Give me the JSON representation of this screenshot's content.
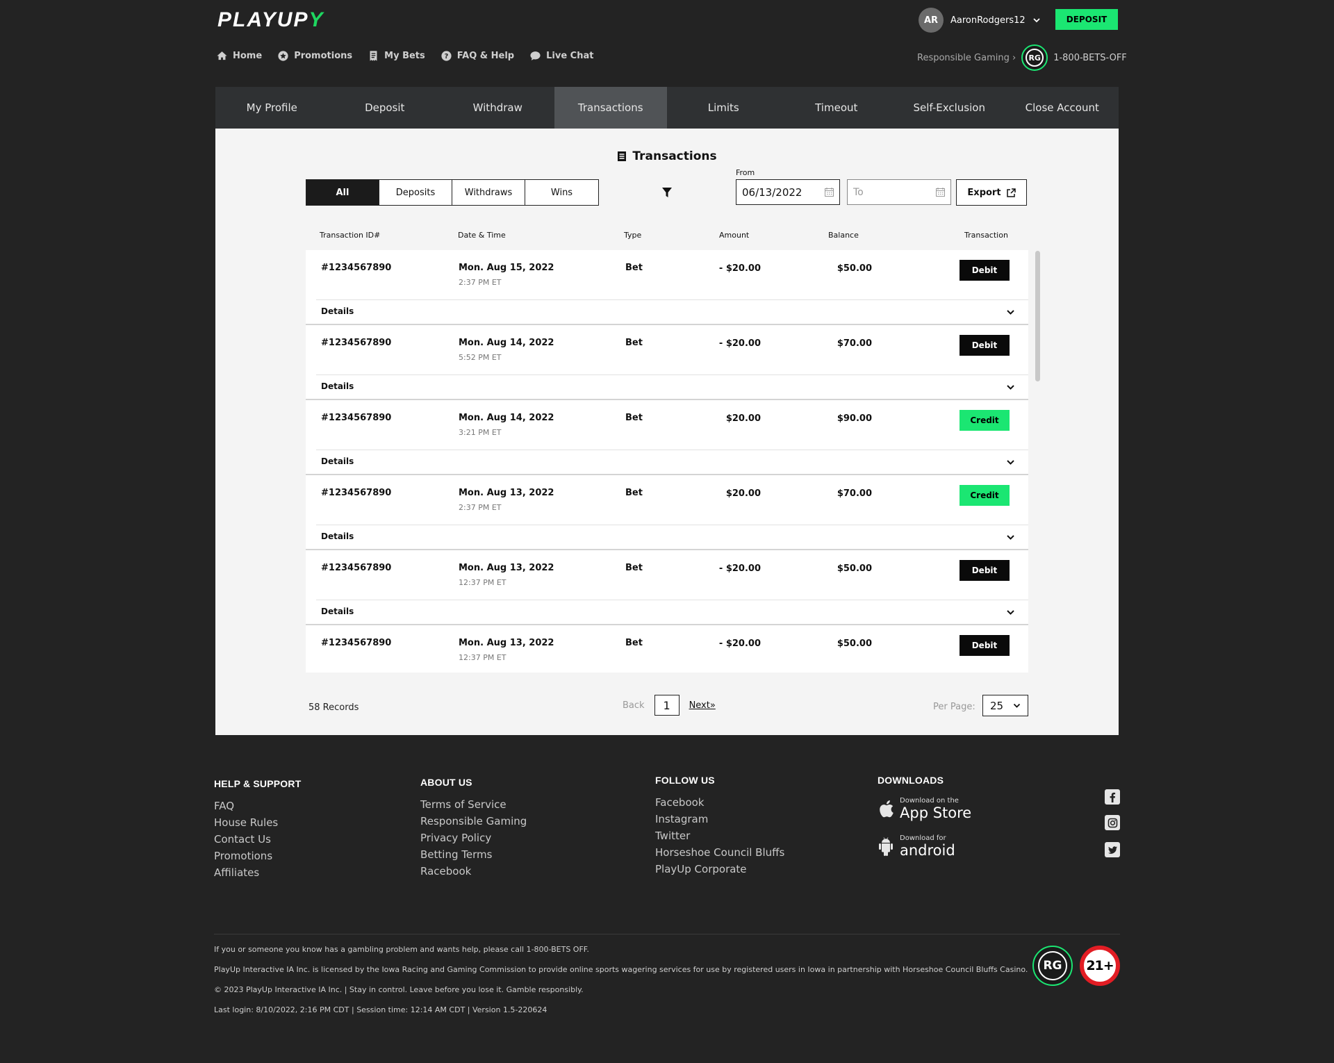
{
  "brand": {
    "logo_text": "PLAYUP",
    "accent": "#1be672"
  },
  "header": {
    "nav": [
      {
        "label": "Home",
        "icon": "home-icon"
      },
      {
        "label": "Promotions",
        "icon": "star-icon"
      },
      {
        "label": "My Bets",
        "icon": "receipt-icon"
      },
      {
        "label": "FAQ & Help",
        "icon": "help-icon"
      },
      {
        "label": "Live Chat",
        "icon": "chat-icon"
      }
    ],
    "user": {
      "initials": "AR",
      "username": "AaronRodgers12"
    },
    "deposit_label": "DEPOSIT",
    "responsible_gaming_label": "Responsible Gaming",
    "rg_badge": "RG",
    "helpline": "1-800-BETS-OFF"
  },
  "account_tabs": [
    {
      "label": "My Profile"
    },
    {
      "label": "Deposit"
    },
    {
      "label": "Withdraw"
    },
    {
      "label": "Transactions",
      "active": true
    },
    {
      "label": "Limits"
    },
    {
      "label": "Timeout"
    },
    {
      "label": "Self-Exclusion"
    },
    {
      "label": "Close Account"
    }
  ],
  "transactions": {
    "title": "Transactions",
    "filters": [
      {
        "label": "All",
        "active": true
      },
      {
        "label": "Deposits"
      },
      {
        "label": "Withdraws"
      },
      {
        "label": "Wins"
      }
    ],
    "from_label": "From",
    "from_value": "06/13/2022",
    "to_placeholder": "To",
    "export_label": "Export",
    "columns": [
      "Transaction ID#",
      "Date & Time",
      "Type",
      "Amount",
      "Balance",
      "Transaction"
    ],
    "details_label": "Details",
    "rows": [
      {
        "id": "#1234567890",
        "date": "Mon. Aug 15, 2022",
        "time": "2:37 PM ET",
        "type": "Bet",
        "amount": "- $20.00",
        "balance": "$50.00",
        "transaction": "Debit"
      },
      {
        "id": "#1234567890",
        "date": "Mon. Aug 14, 2022",
        "time": "5:52 PM ET",
        "type": "Bet",
        "amount": "- $20.00",
        "balance": "$70.00",
        "transaction": "Debit"
      },
      {
        "id": "#1234567890",
        "date": "Mon. Aug 14, 2022",
        "time": "3:21 PM ET",
        "type": "Bet",
        "amount": "$20.00",
        "balance": "$90.00",
        "transaction": "Credit"
      },
      {
        "id": "#1234567890",
        "date": "Mon. Aug 13, 2022",
        "time": "2:37 PM ET",
        "type": "Bet",
        "amount": "$20.00",
        "balance": "$70.00",
        "transaction": "Credit"
      },
      {
        "id": "#1234567890",
        "date": "Mon. Aug 13, 2022",
        "time": "12:37 PM ET",
        "type": "Bet",
        "amount": "- $20.00",
        "balance": "$50.00",
        "transaction": "Debit"
      },
      {
        "id": "#1234567890",
        "date": "Mon. Aug 13, 2022",
        "time": "12:37 PM ET",
        "type": "Bet",
        "amount": "- $20.00",
        "balance": "$50.00",
        "transaction": "Debit"
      }
    ],
    "records_label": "58 Records",
    "pager": {
      "back": "Back",
      "page": "1",
      "next": "Next»"
    },
    "per_page_label": "Per Page:",
    "per_page_value": "25",
    "colors": {
      "debit": "#0a0a0a",
      "credit": "#1be672"
    }
  },
  "footer": {
    "help": {
      "title": "HELP & SUPPORT",
      "links": [
        "FAQ",
        "House Rules",
        "Contact Us",
        "Promotions",
        "Affiliates"
      ]
    },
    "about": {
      "title": "ABOUT US",
      "links": [
        "Terms of Service",
        "Responsible Gaming",
        "Privacy Policy",
        "Betting Terms",
        "Racebook"
      ]
    },
    "follow": {
      "title": "FOLLOW US",
      "links": [
        "Facebook",
        "Instagram",
        "Twitter",
        "Horseshoe Council Bluffs",
        "PlayUp Corporate"
      ]
    },
    "downloads": {
      "title": "DOWNLOADS",
      "appstore": {
        "small": "Download on the",
        "big": "App Store"
      },
      "android": {
        "small": "Download for",
        "big": "android"
      }
    },
    "social_icons": [
      "facebook-icon",
      "instagram-icon",
      "twitter-icon"
    ],
    "legal": [
      "If you or someone you know has a gambling problem and wants help, please call 1-800-BETS OFF.",
      "PlayUp Interactive IA Inc. is licensed by the Iowa Racing and Gaming Commission to provide online sports wagering services for use by registered users in Iowa in partnership with Horseshoe Council Bluffs Casino.",
      "© 2023 PlayUp Interactive IA Inc. | Stay in control. Leave before you lose it. Gamble responsibly.",
      "Last login: 8/10/2022, 2:16 PM CDT | Session time: 12:14 AM CDT | Version 1.5-220624"
    ],
    "rg_badge": "RG",
    "age_badge": "21+"
  }
}
